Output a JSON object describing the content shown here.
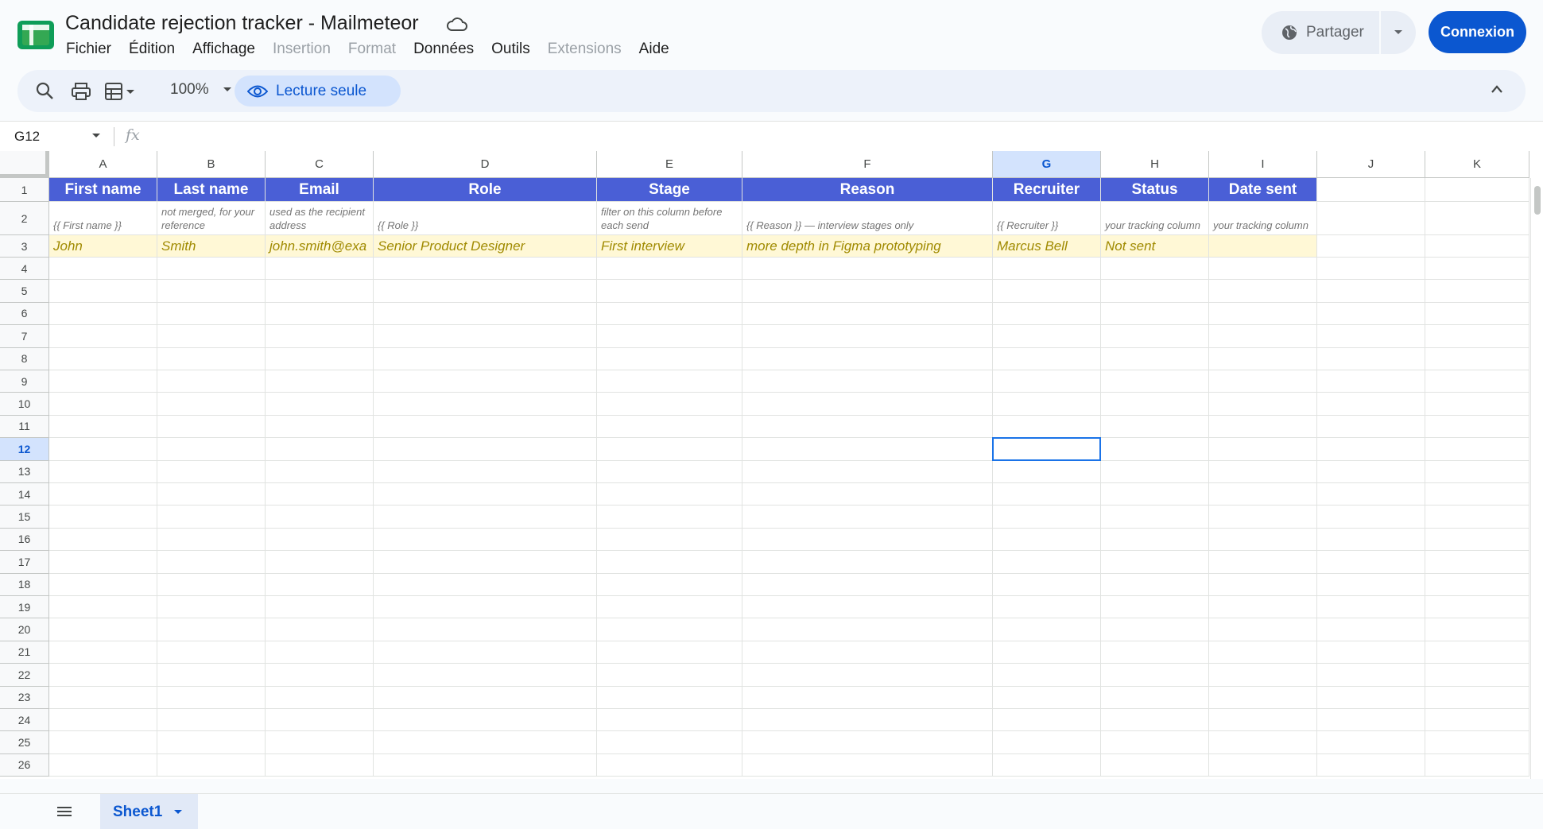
{
  "app": {
    "title": "Candidate rejection tracker - Mailmeteor",
    "menu": [
      "Fichier",
      "Édition",
      "Affichage",
      "Insertion",
      "Format",
      "Données",
      "Outils",
      "Extensions",
      "Aide"
    ],
    "menu_disabled": [
      "Insertion",
      "Format",
      "Extensions"
    ],
    "share_label": "Partager",
    "connect_label": "Connexion"
  },
  "toolbar": {
    "zoom": "100%",
    "readonly_label": "Lecture seule"
  },
  "formula_bar": {
    "cell_ref": "G12",
    "fx": "fx"
  },
  "sheet": {
    "columns": [
      "A",
      "B",
      "C",
      "D",
      "E",
      "F",
      "G",
      "H",
      "I",
      "J",
      "K"
    ],
    "selected_column": "G",
    "selected_row": "12",
    "rows": [
      "1",
      "2",
      "3",
      "4",
      "5",
      "6",
      "7",
      "8",
      "9",
      "10",
      "11",
      "12",
      "13",
      "14",
      "15",
      "16",
      "17",
      "18",
      "19",
      "20",
      "21",
      "22",
      "23",
      "24",
      "25",
      "26"
    ],
    "header_row": [
      "First name",
      "Last name",
      "Email",
      "Role",
      "Stage",
      "Reason",
      "Recruiter",
      "Status",
      "Date sent"
    ],
    "notes_row": [
      "{{ First name }}",
      "not merged, for your reference",
      "used as the recipient address",
      "{{ Role }}",
      "filter on this column before each send",
      "{{ Reason }} — interview stages only",
      "{{ Recruiter }}",
      "your tracking column",
      "your tracking column"
    ],
    "data_row": [
      "John",
      "Smith",
      "john.smith@exa",
      "Senior Product Designer",
      "First interview",
      "more depth in Figma prototyping",
      "Marcus Bell",
      "Not sent",
      ""
    ]
  },
  "tabs": {
    "active": "Sheet1"
  },
  "colors": {
    "accent": "#0b57d0",
    "header_fill": "#4a5fd6",
    "data_fill": "#fff8d6",
    "data_text": "#a08a00"
  }
}
